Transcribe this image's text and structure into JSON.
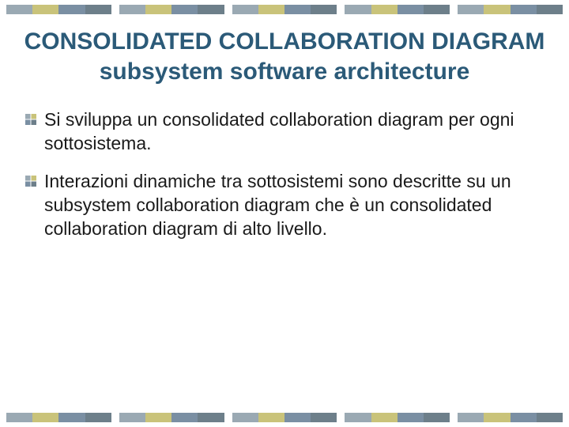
{
  "title_line1": "CONSOLIDATED COLLABORATION DIAGRAM",
  "title_line2": "subsystem software architecture",
  "bullets": [
    "Si sviluppa un consolidated collaboration diagram per ogni sottosistema.",
    "Interazioni dinamiche tra sottosistemi sono descritte su un subsystem collaboration diagram che è un consolidated collaboration diagram di alto livello."
  ],
  "colors": {
    "strip": [
      "#9aa9b3",
      "#c9c37a",
      "#7a8fa3",
      "#6d7f8a"
    ],
    "title": "#2b5a78"
  }
}
